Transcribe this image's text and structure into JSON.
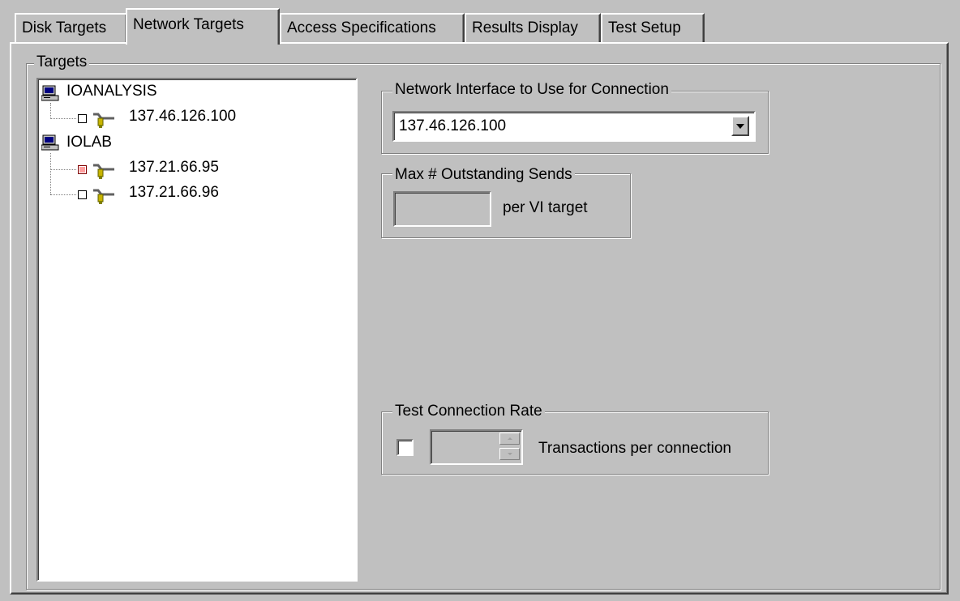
{
  "tabs": [
    {
      "label": "Disk Targets",
      "active": false
    },
    {
      "label": "Network Targets",
      "active": true
    },
    {
      "label": "Access Specifications",
      "active": false
    },
    {
      "label": "Results Display",
      "active": false
    },
    {
      "label": "Test Setup",
      "active": false
    }
  ],
  "targets_group": {
    "label": "Targets",
    "tree": [
      {
        "type": "computer",
        "label": "IOANALYSIS",
        "icon": "computer-icon"
      },
      {
        "type": "nic",
        "label": "137.46.126.100",
        "checked": false,
        "icon": "network-interface-icon"
      },
      {
        "type": "computer",
        "label": "IOLAB",
        "icon": "computer-icon"
      },
      {
        "type": "nic",
        "label": "137.21.66.95",
        "checked": true,
        "icon": "network-interface-icon"
      },
      {
        "type": "nic",
        "label": "137.21.66.96",
        "checked": false,
        "icon": "network-interface-icon"
      }
    ]
  },
  "network_interface": {
    "label": "Network Interface to Use for Connection",
    "value": "137.46.126.100"
  },
  "outstanding_sends": {
    "label": "Max # Outstanding Sends",
    "value": "",
    "suffix": "per VI target"
  },
  "connection_rate": {
    "label": "Test Connection Rate",
    "checked": false,
    "value": "",
    "suffix": "Transactions per connection"
  },
  "colors": {
    "face": "#c0c0c0",
    "highlight": "#ffffff",
    "shadow": "#808080",
    "dark_shadow": "#404040",
    "checked_mark": "#ff9f9f"
  }
}
